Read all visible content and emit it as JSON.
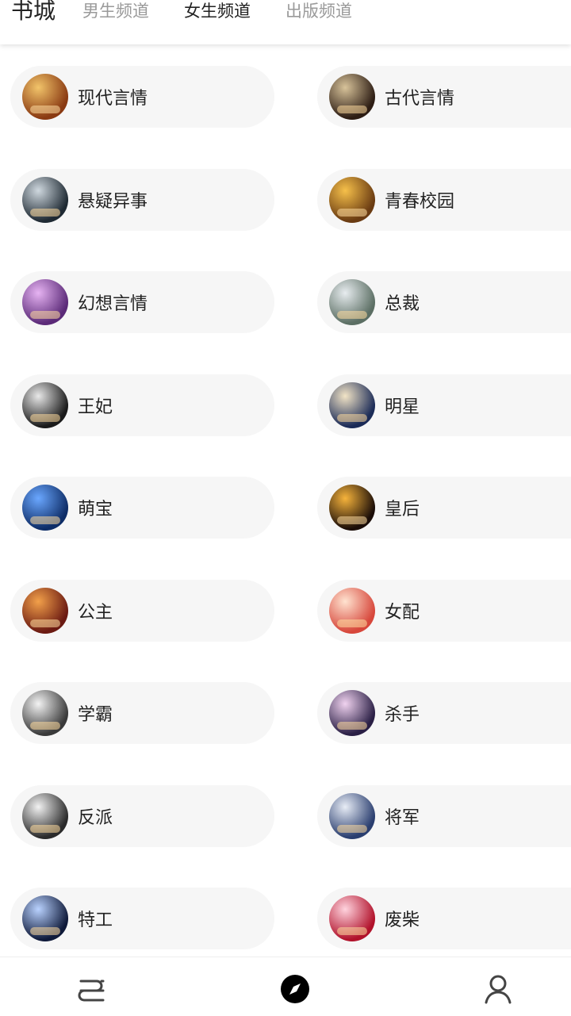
{
  "header": {
    "brand": "书城",
    "tabs": [
      {
        "label": "男生频道",
        "active": false
      },
      {
        "label": "女生频道",
        "active": true
      },
      {
        "label": "出版频道",
        "active": false
      }
    ]
  },
  "categories": [
    {
      "label": "现代言情",
      "colors": [
        "#f2c46a",
        "#8a3a12"
      ]
    },
    {
      "label": "古代言情",
      "colors": [
        "#d8c39a",
        "#2d1d14"
      ]
    },
    {
      "label": "悬疑异事",
      "colors": [
        "#cfd8df",
        "#1f2a33"
      ]
    },
    {
      "label": "青春校园",
      "colors": [
        "#f6c04a",
        "#6a3b12"
      ]
    },
    {
      "label": "幻想言情",
      "colors": [
        "#e6b3f2",
        "#5b2a78"
      ]
    },
    {
      "label": "总裁",
      "colors": [
        "#e7ecef",
        "#5b6e63"
      ]
    },
    {
      "label": "王妃",
      "colors": [
        "#e8e8e8",
        "#1b1b1b"
      ]
    },
    {
      "label": "明星",
      "colors": [
        "#f2e4c6",
        "#1b2b57"
      ]
    },
    {
      "label": "萌宝",
      "colors": [
        "#6aa7ff",
        "#0e2d67"
      ]
    },
    {
      "label": "皇后",
      "colors": [
        "#f6b33b",
        "#1a0d08"
      ]
    },
    {
      "label": "公主",
      "colors": [
        "#f2a04a",
        "#6b1a12"
      ]
    },
    {
      "label": "女配",
      "colors": [
        "#ffe3d0",
        "#d7473b"
      ]
    },
    {
      "label": "学霸",
      "colors": [
        "#f3f3f3",
        "#3a3a3a"
      ]
    },
    {
      "label": "杀手",
      "colors": [
        "#f0d2ef",
        "#2a1f45"
      ]
    },
    {
      "label": "反派",
      "colors": [
        "#f2f2f2",
        "#2b2b2b"
      ]
    },
    {
      "label": "将军",
      "colors": [
        "#e8edf6",
        "#2a3e6f"
      ]
    },
    {
      "label": "特工",
      "colors": [
        "#b9d2ff",
        "#0f1a3a"
      ]
    },
    {
      "label": "废柴",
      "colors": [
        "#ffd3de",
        "#b1122b"
      ]
    }
  ],
  "bottom_nav": {
    "items": [
      {
        "name": "bookshelf-icon"
      },
      {
        "name": "discover-compass-icon"
      },
      {
        "name": "profile-icon"
      }
    ]
  }
}
